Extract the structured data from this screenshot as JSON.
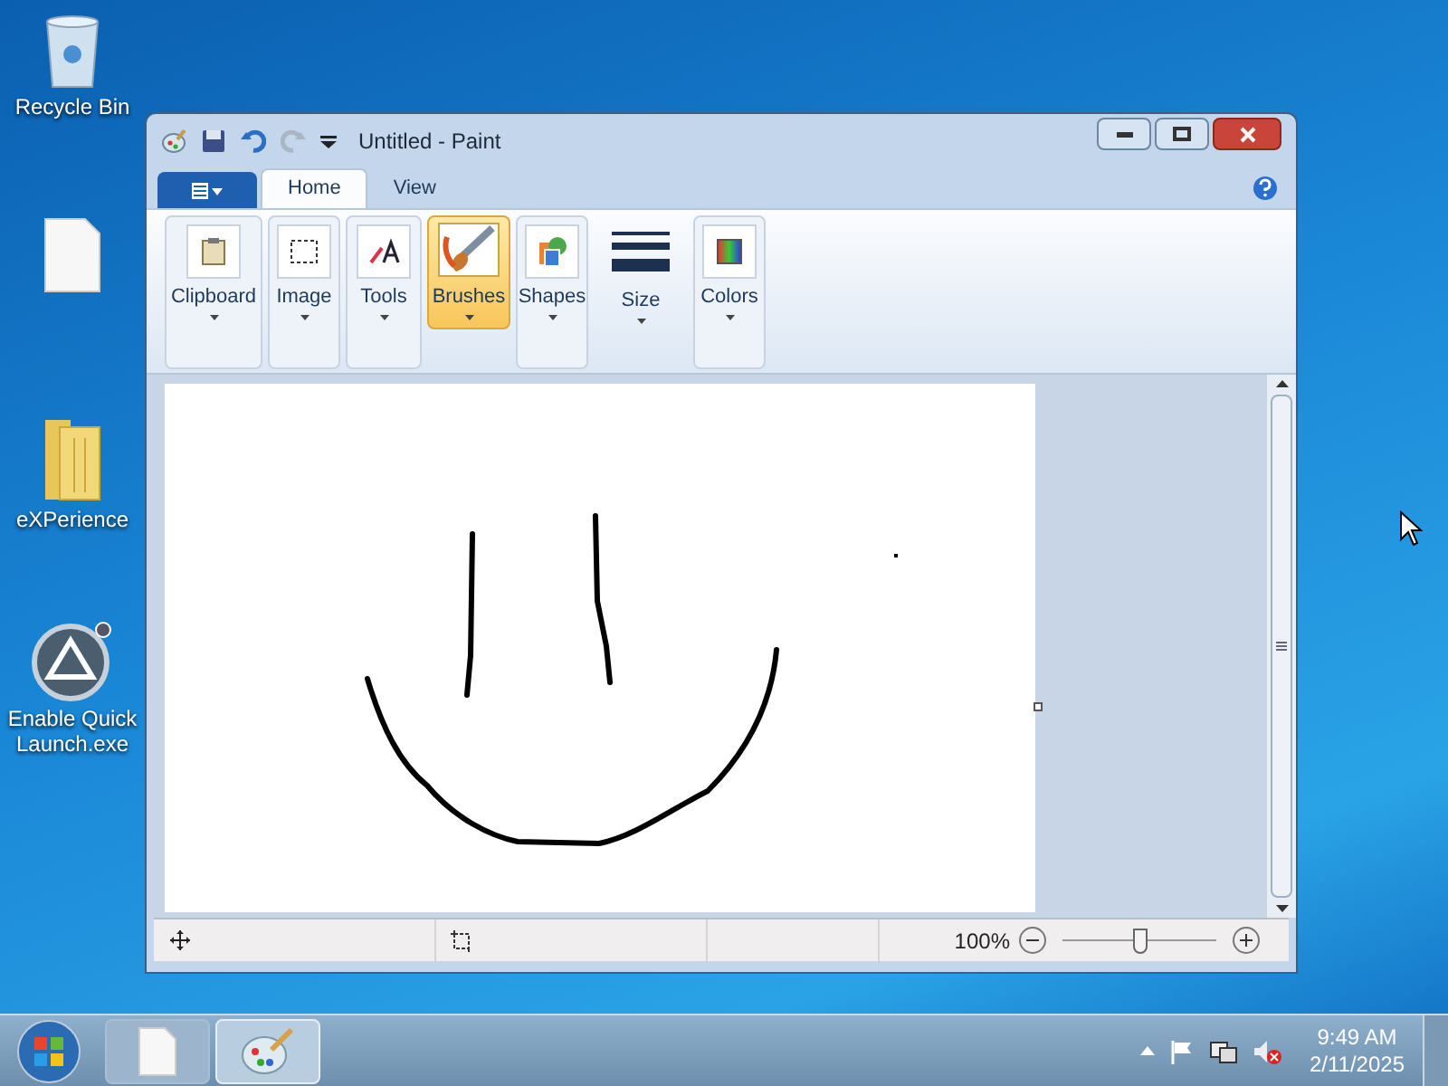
{
  "desktop_icons": [
    {
      "kind": "recycle",
      "label": "Recycle Bin"
    },
    {
      "kind": "file"
    },
    {
      "kind": "folder",
      "label": "eXPerience"
    },
    {
      "kind": "app",
      "label": "Enable Quick Launch.exe"
    }
  ],
  "window": {
    "title": "Untitled - Paint",
    "tabs": [
      {
        "label": "Home",
        "selected": true
      },
      {
        "label": "View",
        "selected": false
      }
    ],
    "ribbon_groups": [
      {
        "kind": "clipboard",
        "label": "Clipboard",
        "selected": false
      },
      {
        "kind": "image",
        "label": "Image",
        "selected": false
      },
      {
        "kind": "tools",
        "label": "Tools",
        "selected": false
      },
      {
        "kind": "brushes",
        "label": "Brushes",
        "selected": true
      },
      {
        "kind": "shapes",
        "label": "Shapes",
        "selected": false
      },
      {
        "kind": "size",
        "label": "Size",
        "selected": false
      },
      {
        "kind": "colors",
        "label": "Colors",
        "selected": false
      }
    ],
    "status_bar": {
      "zoom_reading": "100%",
      "zoom": {
        "level": 0.5
      }
    }
  },
  "taskbar": {
    "items": [
      {
        "kind": "file",
        "selected": false
      },
      {
        "kind": "paint",
        "selected": true
      }
    ],
    "time": "9:49 AM",
    "date": "2/11/2025"
  }
}
